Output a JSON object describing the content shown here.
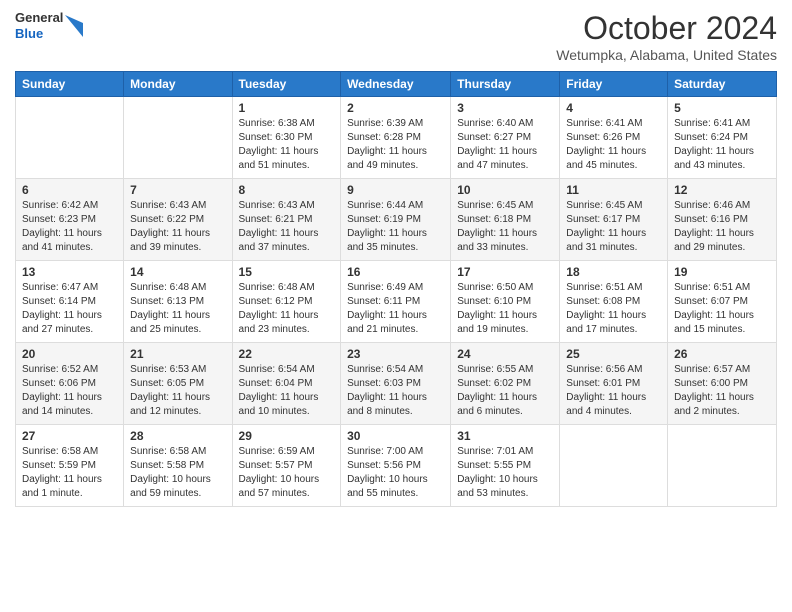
{
  "header": {
    "logo": {
      "general": "General",
      "blue": "Blue"
    },
    "title": "October 2024",
    "location": "Wetumpka, Alabama, United States"
  },
  "weekdays": [
    "Sunday",
    "Monday",
    "Tuesday",
    "Wednesday",
    "Thursday",
    "Friday",
    "Saturday"
  ],
  "weeks": [
    [
      {
        "day": "",
        "info": ""
      },
      {
        "day": "",
        "info": ""
      },
      {
        "day": "1",
        "info": "Sunrise: 6:38 AM\nSunset: 6:30 PM\nDaylight: 11 hours and 51 minutes."
      },
      {
        "day": "2",
        "info": "Sunrise: 6:39 AM\nSunset: 6:28 PM\nDaylight: 11 hours and 49 minutes."
      },
      {
        "day": "3",
        "info": "Sunrise: 6:40 AM\nSunset: 6:27 PM\nDaylight: 11 hours and 47 minutes."
      },
      {
        "day": "4",
        "info": "Sunrise: 6:41 AM\nSunset: 6:26 PM\nDaylight: 11 hours and 45 minutes."
      },
      {
        "day": "5",
        "info": "Sunrise: 6:41 AM\nSunset: 6:24 PM\nDaylight: 11 hours and 43 minutes."
      }
    ],
    [
      {
        "day": "6",
        "info": "Sunrise: 6:42 AM\nSunset: 6:23 PM\nDaylight: 11 hours and 41 minutes."
      },
      {
        "day": "7",
        "info": "Sunrise: 6:43 AM\nSunset: 6:22 PM\nDaylight: 11 hours and 39 minutes."
      },
      {
        "day": "8",
        "info": "Sunrise: 6:43 AM\nSunset: 6:21 PM\nDaylight: 11 hours and 37 minutes."
      },
      {
        "day": "9",
        "info": "Sunrise: 6:44 AM\nSunset: 6:19 PM\nDaylight: 11 hours and 35 minutes."
      },
      {
        "day": "10",
        "info": "Sunrise: 6:45 AM\nSunset: 6:18 PM\nDaylight: 11 hours and 33 minutes."
      },
      {
        "day": "11",
        "info": "Sunrise: 6:45 AM\nSunset: 6:17 PM\nDaylight: 11 hours and 31 minutes."
      },
      {
        "day": "12",
        "info": "Sunrise: 6:46 AM\nSunset: 6:16 PM\nDaylight: 11 hours and 29 minutes."
      }
    ],
    [
      {
        "day": "13",
        "info": "Sunrise: 6:47 AM\nSunset: 6:14 PM\nDaylight: 11 hours and 27 minutes."
      },
      {
        "day": "14",
        "info": "Sunrise: 6:48 AM\nSunset: 6:13 PM\nDaylight: 11 hours and 25 minutes."
      },
      {
        "day": "15",
        "info": "Sunrise: 6:48 AM\nSunset: 6:12 PM\nDaylight: 11 hours and 23 minutes."
      },
      {
        "day": "16",
        "info": "Sunrise: 6:49 AM\nSunset: 6:11 PM\nDaylight: 11 hours and 21 minutes."
      },
      {
        "day": "17",
        "info": "Sunrise: 6:50 AM\nSunset: 6:10 PM\nDaylight: 11 hours and 19 minutes."
      },
      {
        "day": "18",
        "info": "Sunrise: 6:51 AM\nSunset: 6:08 PM\nDaylight: 11 hours and 17 minutes."
      },
      {
        "day": "19",
        "info": "Sunrise: 6:51 AM\nSunset: 6:07 PM\nDaylight: 11 hours and 15 minutes."
      }
    ],
    [
      {
        "day": "20",
        "info": "Sunrise: 6:52 AM\nSunset: 6:06 PM\nDaylight: 11 hours and 14 minutes."
      },
      {
        "day": "21",
        "info": "Sunrise: 6:53 AM\nSunset: 6:05 PM\nDaylight: 11 hours and 12 minutes."
      },
      {
        "day": "22",
        "info": "Sunrise: 6:54 AM\nSunset: 6:04 PM\nDaylight: 11 hours and 10 minutes."
      },
      {
        "day": "23",
        "info": "Sunrise: 6:54 AM\nSunset: 6:03 PM\nDaylight: 11 hours and 8 minutes."
      },
      {
        "day": "24",
        "info": "Sunrise: 6:55 AM\nSunset: 6:02 PM\nDaylight: 11 hours and 6 minutes."
      },
      {
        "day": "25",
        "info": "Sunrise: 6:56 AM\nSunset: 6:01 PM\nDaylight: 11 hours and 4 minutes."
      },
      {
        "day": "26",
        "info": "Sunrise: 6:57 AM\nSunset: 6:00 PM\nDaylight: 11 hours and 2 minutes."
      }
    ],
    [
      {
        "day": "27",
        "info": "Sunrise: 6:58 AM\nSunset: 5:59 PM\nDaylight: 11 hours and 1 minute."
      },
      {
        "day": "28",
        "info": "Sunrise: 6:58 AM\nSunset: 5:58 PM\nDaylight: 10 hours and 59 minutes."
      },
      {
        "day": "29",
        "info": "Sunrise: 6:59 AM\nSunset: 5:57 PM\nDaylight: 10 hours and 57 minutes."
      },
      {
        "day": "30",
        "info": "Sunrise: 7:00 AM\nSunset: 5:56 PM\nDaylight: 10 hours and 55 minutes."
      },
      {
        "day": "31",
        "info": "Sunrise: 7:01 AM\nSunset: 5:55 PM\nDaylight: 10 hours and 53 minutes."
      },
      {
        "day": "",
        "info": ""
      },
      {
        "day": "",
        "info": ""
      }
    ]
  ]
}
